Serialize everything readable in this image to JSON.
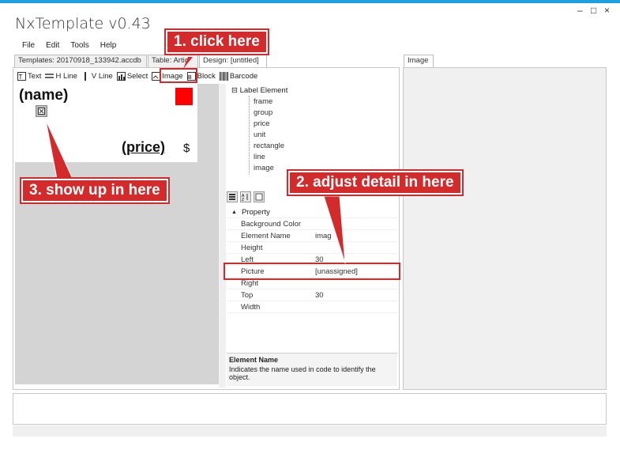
{
  "window": {
    "title": "NxTemplate v0.43",
    "minimize": "–",
    "maximize": "□",
    "close": "×"
  },
  "menu": [
    "File",
    "Edit",
    "Tools",
    "Help"
  ],
  "tabs": {
    "templates": "Templates: 20170918_133942.accdb",
    "table": "Table: Artic",
    "design": "Design: [untitled]",
    "image": "Image"
  },
  "toolbar": {
    "text": "Text",
    "hline": "H Line",
    "vline": "V Line",
    "select": "Select",
    "image": "Image",
    "block": "Block",
    "barcode": "Barcode"
  },
  "label": {
    "name": "(name)",
    "price": "(price)",
    "currency": "$",
    "rect_color": "#ff0000"
  },
  "tree": {
    "root": "Label Element",
    "toggle": "⊟",
    "items": [
      "frame",
      "group",
      "price",
      "unit",
      "rectangle",
      "line",
      "image"
    ]
  },
  "property_grid": {
    "category": "Property",
    "rows": [
      {
        "key": "Background Color",
        "value": ""
      },
      {
        "key": "Element Name",
        "value": "imag"
      },
      {
        "key": "Height",
        "value": ""
      },
      {
        "key": "Left",
        "value": "30"
      },
      {
        "key": "Picture",
        "value": "[unassigned]"
      },
      {
        "key": "Right",
        "value": ""
      },
      {
        "key": "Top",
        "value": "30"
      },
      {
        "key": "Width",
        "value": ""
      }
    ]
  },
  "description": {
    "title": "Element Name",
    "text": "Indicates the name used in code to identify the object."
  },
  "callouts": {
    "c1": "1. click here",
    "c2": "2. adjust detail in here",
    "c3": "3. show up in here"
  },
  "accent_color": "#d32b2b"
}
